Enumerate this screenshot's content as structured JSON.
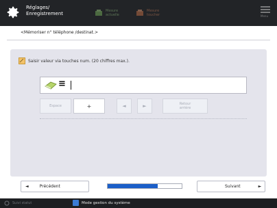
{
  "header": {
    "title_line1": "Réglages/",
    "title_line2": "Enregistrement",
    "btn1_label": "Mesure\nactuelle",
    "btn2_label": "Mesure\ntoucher",
    "menu_label": "Menu"
  },
  "subtitle": "<Mémoriser n° téléphone /destinat.>",
  "instruction": "Saisir valeur via touches num. (20 chiffres max.).",
  "input": {
    "symbol": "≡",
    "value": ""
  },
  "keys": {
    "space": "Espace",
    "plus": "+",
    "left": "◄",
    "right": "►",
    "backspace": "Retour\narrière"
  },
  "nav": {
    "prev_label": "Précédent",
    "prev_arrow": "◄",
    "next_label": "Suivant",
    "next_arrow": "►",
    "progress": 0.68
  },
  "status": {
    "left_text": "Suivi statut",
    "mode_text": "Mode gestion du système"
  },
  "colors": {
    "header_bg": "#222427",
    "panel_bg": "#e4e4ec",
    "progress_fill": "#1b5fc8"
  }
}
